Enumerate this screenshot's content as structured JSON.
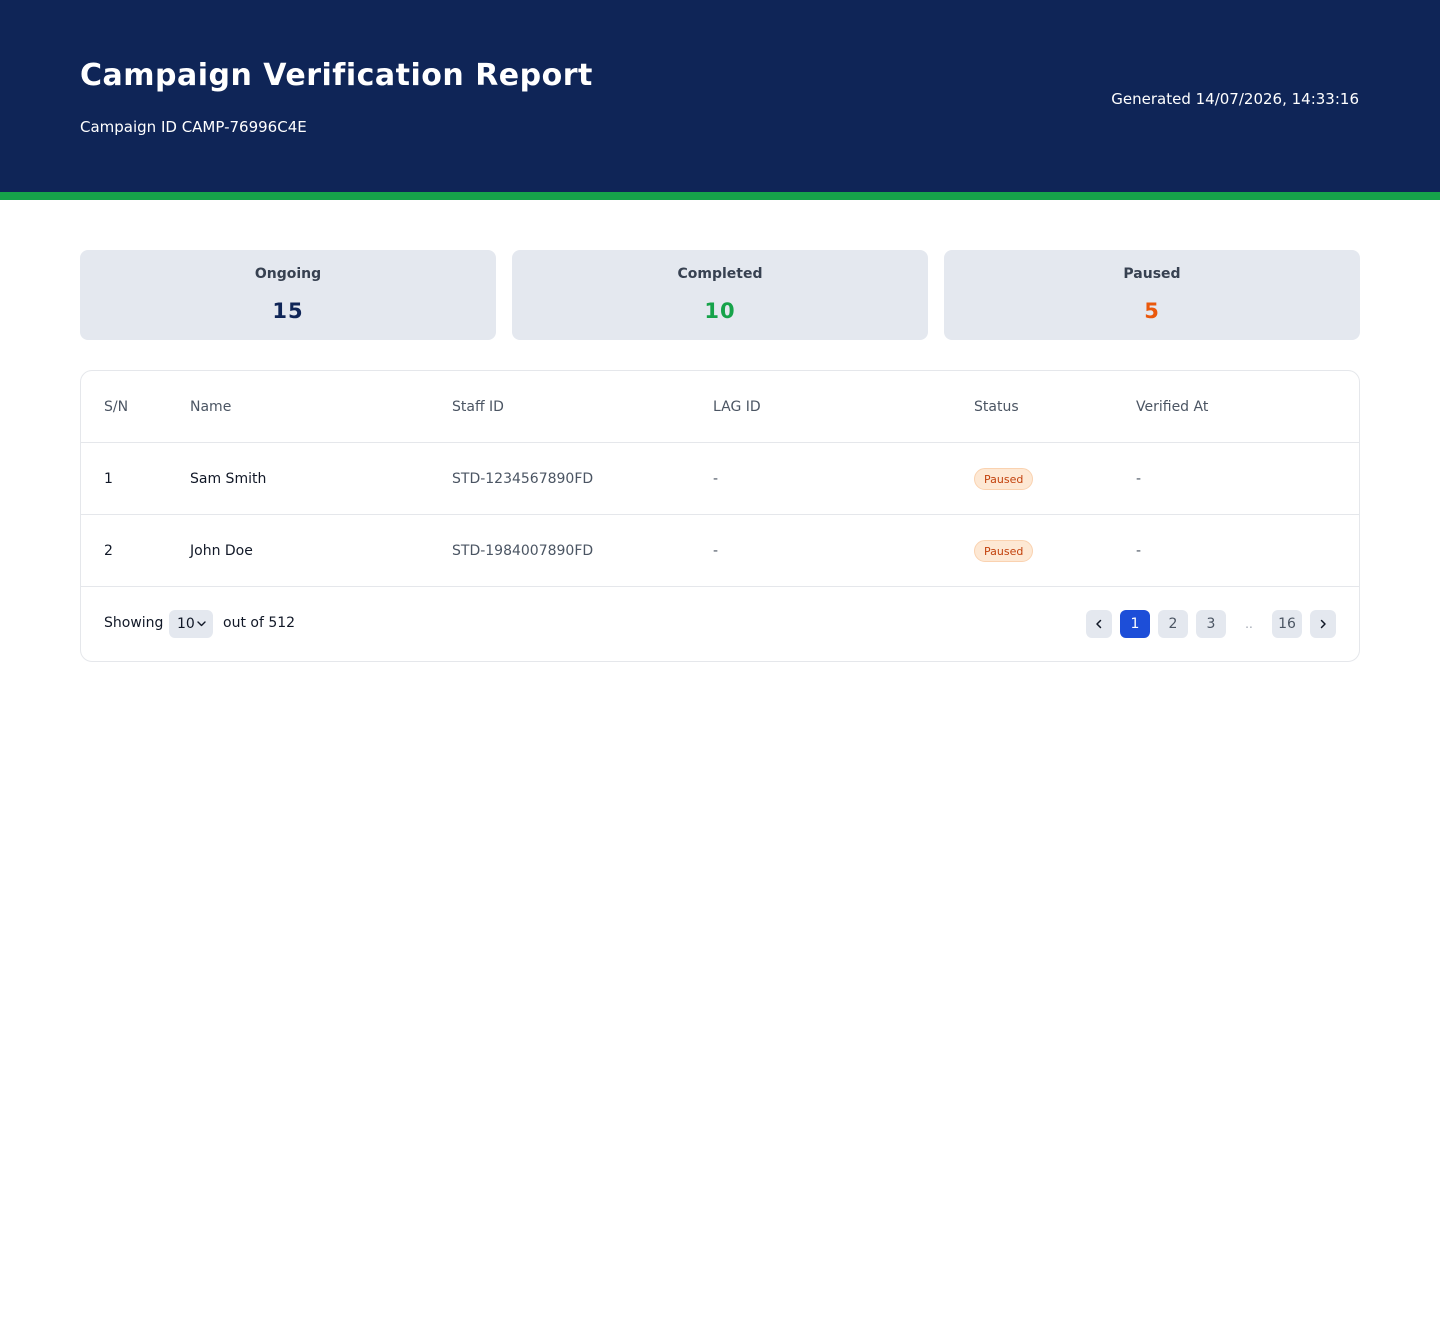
{
  "header": {
    "title": "Campaign Verification Report",
    "campaign_id": "Campaign ID CAMP-76996C4E",
    "generated": "Generated 14/07/2026, 14:33:16"
  },
  "colors": {
    "header_bg": "#0f2557",
    "accent_stripe": "#16a34a",
    "ongoing": "#0f2557",
    "completed": "#16a34a",
    "paused": "#ea580c",
    "pagination_active": "#1d4ed8"
  },
  "stats": [
    {
      "label": "Ongoing",
      "value": "15"
    },
    {
      "label": "Completed",
      "value": "10"
    },
    {
      "label": "Paused",
      "value": "5"
    }
  ],
  "table": {
    "columns": [
      "S/N",
      "Name",
      "Staff ID",
      "LAG ID",
      "Status",
      "Verified At"
    ],
    "rows": [
      {
        "sn": "1",
        "name": "Sam Smith",
        "staff_id": "STD-1234567890FD",
        "lag_id": "-",
        "status": "Paused",
        "verified_at": "-"
      },
      {
        "sn": "2",
        "name": "John Doe",
        "staff_id": "STD-1984007890FD",
        "lag_id": "-",
        "status": "Paused",
        "verified_at": "-"
      }
    ]
  },
  "footer": {
    "showing_label": "Showing",
    "page_size": "10",
    "out_of": "out of 512",
    "pages": [
      "1",
      "2",
      "3",
      "..",
      "16"
    ],
    "current_page": "1",
    "prev_icon": "chevron-left-icon",
    "next_icon": "chevron-right-icon",
    "dropdown_icon": "chevron-down-icon"
  }
}
